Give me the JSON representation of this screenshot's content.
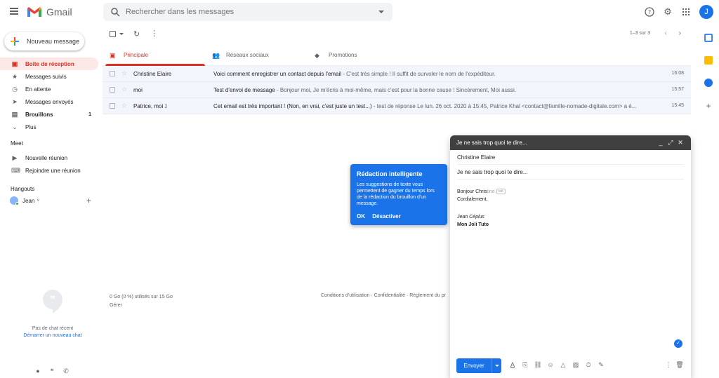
{
  "app": {
    "name": "Gmail"
  },
  "search": {
    "placeholder": "Rechercher dans les messages"
  },
  "header_icons": {
    "help": "?",
    "settings": "⚙",
    "apps": "⋮⋮",
    "avatar_letter": "J"
  },
  "colors": {
    "accent": "#1a73e8",
    "active": "#d93025",
    "active_bg": "#fce8e6"
  },
  "compose_button": {
    "label": "Nouveau message"
  },
  "nav": [
    {
      "label": "Boîte de réception",
      "icon": "inbox-icon",
      "glyph": "▣",
      "active": true
    },
    {
      "label": "Messages suivis",
      "icon": "star-icon",
      "glyph": "★"
    },
    {
      "label": "En attente",
      "icon": "clock-icon",
      "glyph": "◷"
    },
    {
      "label": "Messages envoyés",
      "icon": "send-icon",
      "glyph": "➤"
    },
    {
      "label": "Brouillons",
      "icon": "draft-icon",
      "glyph": "▤",
      "count": "1",
      "bold": true
    },
    {
      "label": "Plus",
      "icon": "chevron-down-icon",
      "glyph": "⌄"
    }
  ],
  "meet": {
    "title": "Meet",
    "items": [
      {
        "label": "Nouvelle réunion",
        "glyph": "▶"
      },
      {
        "label": "Rejoindre une réunion",
        "glyph": "⌨"
      }
    ]
  },
  "hangouts": {
    "title": "Hangouts",
    "user": "Jean",
    "user_caret": "˅",
    "plus": "+"
  },
  "no_chat": {
    "text": "Pas de chat récent",
    "link": "Démarrer un nouveau chat"
  },
  "toolbar": {
    "range": "1–3 sur 3",
    "refresh": "↻",
    "more": "⋮",
    "prev": "‹",
    "next": "›"
  },
  "tabs": [
    {
      "label": "Principale",
      "glyph": "▣",
      "active": true
    },
    {
      "label": "Réseaux sociaux",
      "glyph": "👥"
    },
    {
      "label": "Promotions",
      "glyph": "◆"
    }
  ],
  "emails": [
    {
      "sender": "Christine Elaire",
      "count": "",
      "subject": "Voici comment enregistrer un contact depuis l'email",
      "snippet": " - C'est très simple ! Il suffit de survoler le nom de l'expéditeur.",
      "time": "16:08"
    },
    {
      "sender": "moi",
      "count": "",
      "subject": "Test d'envoi de message",
      "snippet": " - Bonjour moi, Je m'écris à moi-même, mais c'est pour la bonne cause ! Sincèrement, Moi aussi.",
      "time": "15:57"
    },
    {
      "sender": "Patrice, moi",
      "count": "2",
      "subject": "Cet email est très important ! (Non, en vrai, c'est juste un test...)",
      "snippet": " - test de réponse Le lun. 26 oct. 2020 à 15:45, Patrice Khal <contact@famille-nomade-digitale.com> a é...",
      "time": "15:45"
    }
  ],
  "footer": {
    "storage": "0 Go (0 %) utilisés sur 15 Go",
    "manage": "Gérer",
    "links": "Conditions d'utilisation · Confidentialité · Règlement du pr"
  },
  "smart_compose": {
    "title": "Rédaction intelligente",
    "body": "Les suggestions de texte vous permettent de gagner du temps lors de la rédaction du brouillon d'un message.",
    "ok": "OK",
    "disable": "Désactiver"
  },
  "compose": {
    "title": "Je ne sais trop quoi te dire...",
    "to": "Christine Elaire",
    "subject": "Je ne sais trop quoi te dire...",
    "body_typed": "Bonjour Chris",
    "body_suggestion": "tine",
    "tab_hint": "tab",
    "line2": "Cordialement,",
    "sig_name": "Jean Céplus",
    "sig_company": "Mon Joli Tuto",
    "send_label": "Envoyer",
    "controls": {
      "minimize": "_",
      "expand": "⤢",
      "close": "✕"
    },
    "check": "✓"
  }
}
